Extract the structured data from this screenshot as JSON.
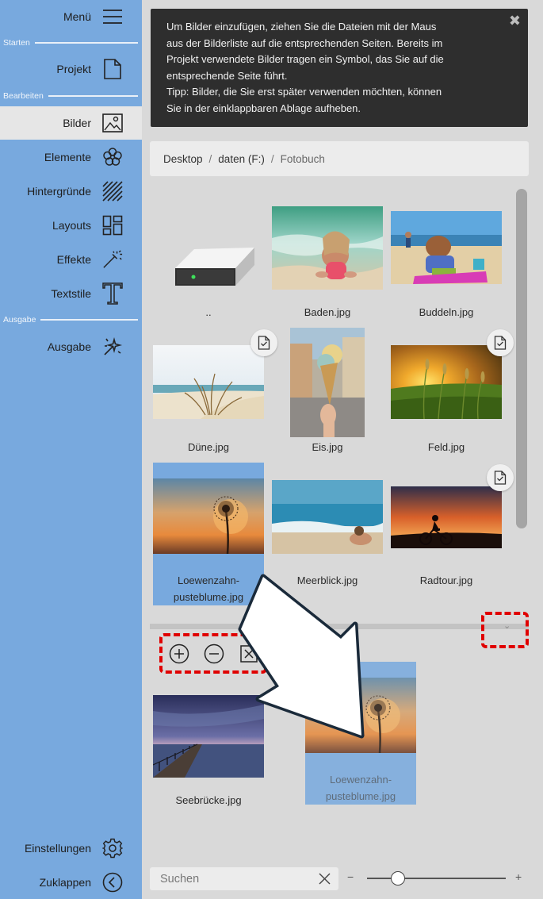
{
  "sidebar": {
    "menu_label": "Menü",
    "sections": {
      "start": "Starten",
      "edit": "Bearbeiten",
      "output": "Ausgabe"
    },
    "items": [
      {
        "label": "Projekt",
        "icon": "document-icon"
      },
      {
        "label": "Bilder",
        "icon": "image-icon",
        "active": true
      },
      {
        "label": "Elemente",
        "icon": "flower-icon"
      },
      {
        "label": "Hintergründe",
        "icon": "hatch-pattern-icon"
      },
      {
        "label": "Layouts",
        "icon": "layout-grid-icon"
      },
      {
        "label": "Effekte",
        "icon": "magic-wand-icon"
      },
      {
        "label": "Textstile",
        "icon": "text-t-icon"
      },
      {
        "label": "Ausgabe",
        "icon": "sparkle-output-icon"
      }
    ],
    "settings_label": "Einstellungen",
    "collapse_label": "Zuklappen",
    "background_color": "#78a9de"
  },
  "info": {
    "text_lines": [
      "Um Bilder einzufügen, ziehen Sie die Dateien mit der Maus",
      "aus der Bilderliste auf die entsprechenden Seiten. Bereits im",
      "Projekt verwendete Bilder tragen ein Symbol, das Sie auf die",
      "entsprechende Seite führt.",
      "Tipp: Bilder, die Sie erst später verwenden möchten, können",
      "Sie in der einklappbaren Ablage aufheben."
    ],
    "close_glyph": "✖"
  },
  "breadcrumb": {
    "items": [
      "Desktop",
      "daten (F:)",
      "Fotobuch"
    ],
    "separator": "/"
  },
  "gallery": {
    "files": [
      {
        "name": "..",
        "kind": "drive"
      },
      {
        "name": "Baden.jpg",
        "used": false
      },
      {
        "name": "Buddeln.jpg",
        "used": false
      },
      {
        "name": "Düne.jpg",
        "used": true
      },
      {
        "name": "Eis.jpg",
        "used": false
      },
      {
        "name": "Feld.jpg",
        "used": true
      },
      {
        "name": "Loewenzahn-pusteblume.jpg",
        "caption_lines": [
          "Loewenzahn-",
          "pusteblume.jpg"
        ],
        "selected": true
      },
      {
        "name": "Meerblick.jpg",
        "used": false
      },
      {
        "name": "Radtour.jpg",
        "used": true
      }
    ]
  },
  "tray": {
    "tools": [
      {
        "name": "add-icon",
        "glyph": "+"
      },
      {
        "name": "remove-icon",
        "glyph": "−"
      },
      {
        "name": "clear-icon",
        "glyph": "×"
      }
    ],
    "files": [
      {
        "name": "Seebrücke.jpg"
      },
      {
        "name": "Loewenzahn-pusteblume.jpg",
        "caption_lines": [
          "Loewenzahn-",
          "pusteblume.jpg"
        ],
        "dragging": true
      }
    ]
  },
  "search": {
    "placeholder": "Suchen",
    "value": ""
  },
  "zoom": {
    "minus": "−",
    "plus": "+",
    "level": 0.22
  },
  "colors": {
    "accent": "#78a9de",
    "highlight": "#e00000",
    "info_bg": "#2e2e2e"
  }
}
